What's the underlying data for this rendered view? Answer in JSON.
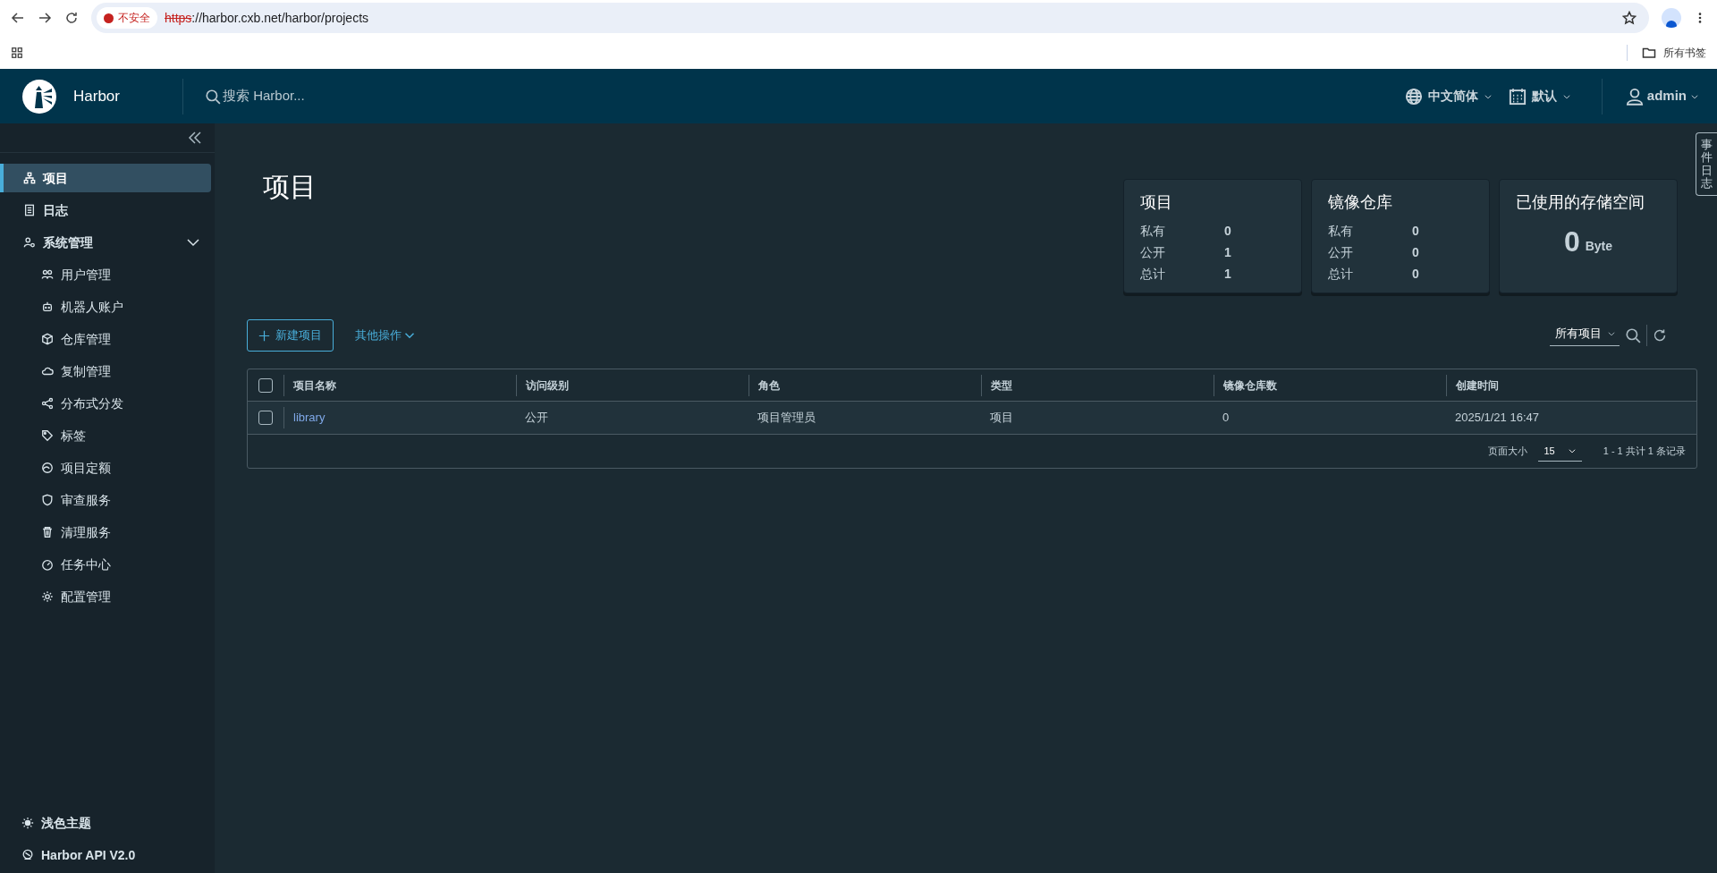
{
  "browser": {
    "security": "不安全",
    "url_scheme": "https",
    "url_rest": "://harbor.cxb.net/harbor/projects",
    "bookmarks": "所有书签"
  },
  "header": {
    "brand": "Harbor",
    "search_placeholder": "搜索 Harbor...",
    "language": "中文简体",
    "theme": "默认",
    "user": "admin"
  },
  "sidebar": {
    "items": [
      {
        "label": "项目",
        "selected": true
      },
      {
        "label": "日志",
        "selected": false
      },
      {
        "label": "系统管理",
        "selected": false,
        "expanded": true,
        "children": [
          {
            "label": "用户管理",
            "selected": false
          },
          {
            "label": "机器人账户",
            "selected": false
          },
          {
            "label": "仓库管理",
            "selected": false
          },
          {
            "label": "复制管理",
            "selected": false
          },
          {
            "label": "分布式分发",
            "selected": false
          },
          {
            "label": "标签",
            "selected": false
          },
          {
            "label": "项目定额",
            "selected": false
          },
          {
            "label": "审查服务",
            "selected": false
          },
          {
            "label": "清理服务",
            "selected": false
          },
          {
            "label": "任务中心",
            "selected": false
          },
          {
            "label": "配置管理",
            "selected": false
          }
        ]
      }
    ],
    "footer": [
      "浅色主题",
      "Harbor API V2.0"
    ]
  },
  "page_title": "项目",
  "cards": [
    {
      "kind": "counts",
      "title": "项目",
      "rows": [
        [
          "私有",
          "0"
        ],
        [
          "公开",
          "1"
        ],
        [
          "总计",
          "1"
        ]
      ]
    },
    {
      "kind": "counts",
      "title": "镜像仓库",
      "rows": [
        [
          "私有",
          "0"
        ],
        [
          "公开",
          "0"
        ],
        [
          "总计",
          "0"
        ]
      ]
    },
    {
      "kind": "storage",
      "title": "已使用的存储空间",
      "value": "0",
      "unit": "Byte"
    }
  ],
  "event_log_tab": "事件日志",
  "toolbar": {
    "new_button": "新建项目",
    "more_actions": "其他操作",
    "filter": "所有项目"
  },
  "table": {
    "columns": [
      "项目名称",
      "访问级别",
      "角色",
      "类型",
      "镜像仓库数",
      "创建时间"
    ],
    "header_checked": false,
    "rows": [
      {
        "checked": false,
        "cells": [
          "library",
          "公开",
          "项目管理员",
          "项目",
          "0",
          "2025/1/21 16:47"
        ]
      }
    ],
    "page_size_label": "页面大小",
    "page_size": "15",
    "summary": "1 - 1 共计 1 条记录"
  }
}
